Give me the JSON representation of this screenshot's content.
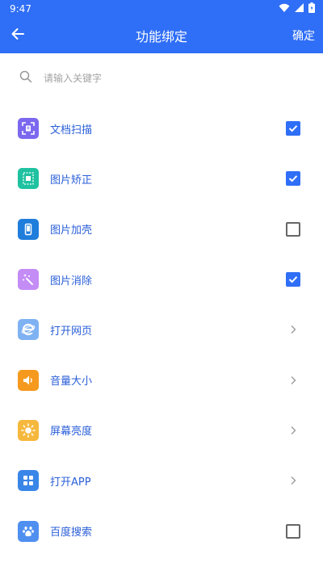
{
  "status": {
    "time": "9:47"
  },
  "header": {
    "title": "功能绑定",
    "confirm_label": "确定"
  },
  "search": {
    "placeholder": "请输入关键字"
  },
  "items": [
    {
      "label": "文档扫描",
      "icon": "document-scan-icon",
      "color": "#7b68ee",
      "control": "checkbox",
      "checked": true
    },
    {
      "label": "图片矫正",
      "icon": "image-correct-icon",
      "color": "#1fc2a0",
      "control": "checkbox",
      "checked": true
    },
    {
      "label": "图片加壳",
      "icon": "phone-frame-icon",
      "color": "#1f7ddb",
      "control": "checkbox",
      "checked": false
    },
    {
      "label": "图片消除",
      "icon": "magic-wand-icon",
      "color": "#c48cf5",
      "control": "checkbox",
      "checked": true
    },
    {
      "label": "打开网页",
      "icon": "browser-icon",
      "color": "#7fb2f2",
      "control": "chevron"
    },
    {
      "label": "音量大小",
      "icon": "volume-icon",
      "color": "#f59a1e",
      "control": "chevron"
    },
    {
      "label": "屏幕亮度",
      "icon": "brightness-icon",
      "color": "#f5b83d",
      "control": "chevron"
    },
    {
      "label": "打开APP",
      "icon": "apps-grid-icon",
      "color": "#3a86e8",
      "control": "chevron"
    },
    {
      "label": "百度搜索",
      "icon": "baidu-paw-icon",
      "color": "#4f8ff0",
      "control": "checkbox",
      "checked": false
    }
  ],
  "colors": {
    "accent": "#2f6ef6",
    "label": "#2a5fd8"
  }
}
